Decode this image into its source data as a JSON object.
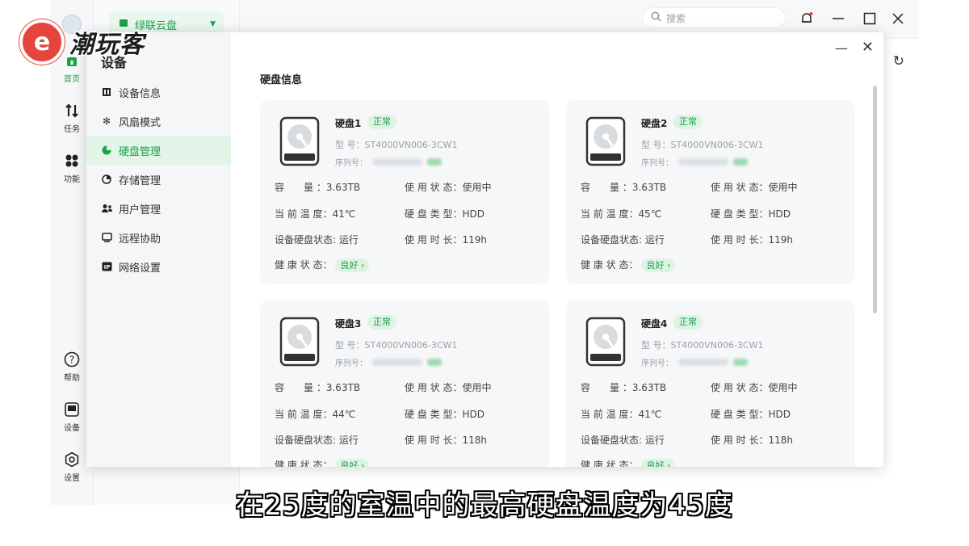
{
  "watermark": {
    "brand_text": "潮玩客"
  },
  "rail": {
    "items": [
      {
        "label": "首页",
        "icon": "home-icon"
      },
      {
        "label": "任务",
        "icon": "transfer-icon"
      },
      {
        "label": "功能",
        "icon": "apps-icon"
      },
      {
        "label": "帮助",
        "icon": "help-icon"
      },
      {
        "label": "设备",
        "icon": "device-icon"
      },
      {
        "label": "设置",
        "icon": "settings-icon"
      }
    ]
  },
  "left_panel": {
    "cloud_label": "绿联云盘"
  },
  "topbar": {
    "search_placeholder": "搜索"
  },
  "dialog": {
    "title": "设备",
    "menu": [
      {
        "label": "设备信息",
        "icon": "info-icon"
      },
      {
        "label": "风扇模式",
        "icon": "fan-icon"
      },
      {
        "label": "硬盘管理",
        "icon": "disk-icon"
      },
      {
        "label": "存储管理",
        "icon": "storage-icon"
      },
      {
        "label": "用户管理",
        "icon": "users-icon"
      },
      {
        "label": "远程协助",
        "icon": "remote-icon"
      },
      {
        "label": "网络设置",
        "icon": "network-icon"
      }
    ],
    "active_menu": "硬盘管理",
    "section_title": "硬盘信息",
    "labels": {
      "model": "型 号：",
      "serial": "序列号：",
      "capacity": "容　　量",
      "usage_status": "使 用 状 态：",
      "temperature": "当 前 温 度：",
      "disk_type": "硬 盘 类 型：",
      "disk_state": "设备硬盘状态:",
      "duration": "使 用 时 长：",
      "health": "健 康 状 态：",
      "colon": "："
    },
    "disks": [
      {
        "name": "硬盘1",
        "status": "正常",
        "model": "ST4000VN006-3CW1",
        "capacity": "3.63TB",
        "usage": "使用中",
        "temp": "41℃",
        "type": "HDD",
        "state": "运行",
        "duration": "119h",
        "health": "良好 ›"
      },
      {
        "name": "硬盘2",
        "status": "正常",
        "model": "ST4000VN006-3CW1",
        "capacity": "3.63TB",
        "usage": "使用中",
        "temp": "45℃",
        "type": "HDD",
        "state": "运行",
        "duration": "119h",
        "health": "良好 ›"
      },
      {
        "name": "硬盘3",
        "status": "正常",
        "model": "ST4000VN006-3CW1",
        "capacity": "3.63TB",
        "usage": "使用中",
        "temp": "44℃",
        "type": "HDD",
        "state": "运行",
        "duration": "118h",
        "health": "良好 ›"
      },
      {
        "name": "硬盘4",
        "status": "正常",
        "model": "ST4000VN006-3CW1",
        "capacity": "3.63TB",
        "usage": "使用中",
        "temp": "41℃",
        "type": "HDD",
        "state": "运行",
        "duration": "118h",
        "health": "良好 ›"
      }
    ]
  },
  "subtitle": "在25度的室温中的最高硬盘温度为45度",
  "colors": {
    "accent": "#1aa34a",
    "logo_red": "#e5463b"
  }
}
